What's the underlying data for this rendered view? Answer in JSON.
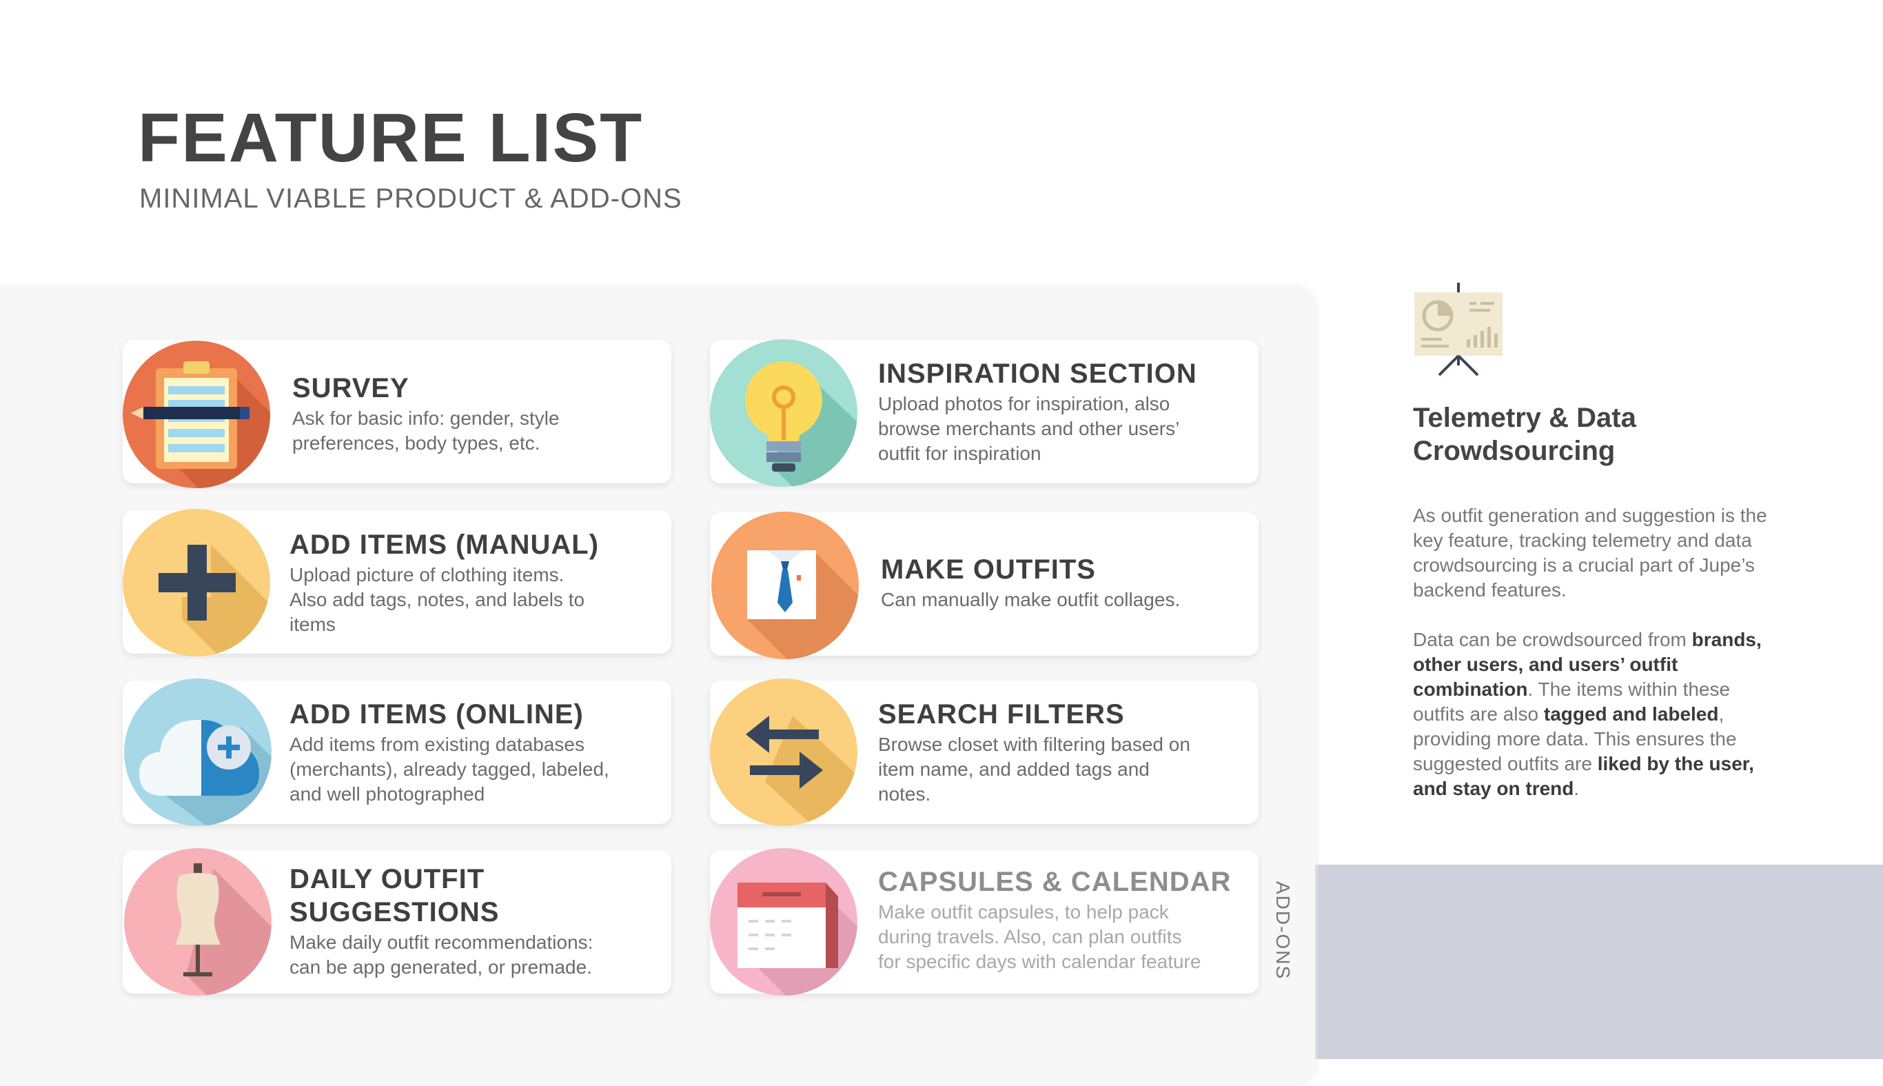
{
  "header": {
    "title": "FEATURE LIST",
    "subtitle": "MINIMAL VIABLE PRODUCT & ADD-ONS"
  },
  "features": [
    {
      "title": "SURVEY",
      "desc": "Ask for basic info: gender, style\npreferences, body types, etc.",
      "icon": "survey-clipboard-icon"
    },
    {
      "title": "INSPIRATION SECTION",
      "desc": "Upload photos for inspiration, also\nbrowse merchants and other users’\noutfit for inspiration",
      "icon": "lightbulb-icon"
    },
    {
      "title": "ADD ITEMS (MANUAL)",
      "desc": "Upload picture of clothing items.\nAlso add tags, notes, and labels to\nitems",
      "icon": "plus-icon"
    },
    {
      "title": "MAKE OUTFITS",
      "desc": "Can manually make outfit collages.",
      "icon": "shirt-tie-icon"
    },
    {
      "title": "ADD ITEMS (ONLINE)",
      "desc": "Add items from existing databases\n(merchants), already tagged, labeled,\nand well photographed",
      "icon": "cloud-add-icon"
    },
    {
      "title": "SEARCH FILTERS",
      "desc": "Browse closet with filtering based on\nitem name, and added tags and\nnotes.",
      "icon": "swap-arrows-icon"
    },
    {
      "title": "DAILY OUTFIT\nSUGGESTIONS",
      "desc": "Make daily outfit recommendations:\ncan be app generated, or premade.",
      "icon": "mannequin-icon"
    },
    {
      "title": "CAPSULES & CALENDAR",
      "desc": "Make outfit capsules, to help pack\nduring travels. Also, can plan outfits\nfor specific days with calendar feature",
      "icon": "calendar-icon"
    }
  ],
  "addons_label": "ADD-ONS",
  "sidebar": {
    "icon": "presentation-board-icon",
    "title": "Telemetry & Data\nCrowdsourcing",
    "para1": "As outfit generation and suggestion is the key feature, tracking telemetry and data crowdsourcing is a crucial part of Jupe’s backend features.",
    "para2": {
      "t1": "Data can be crowdsourced from ",
      "b1": "brands, other users, and users’ outfit combination",
      "t2": ". The items within these outfits are also ",
      "b2": "tagged and labeled",
      "t3": ", providing more data. This ensures the suggested outfits are ",
      "b3": "liked by the user, and stay on trend",
      "t4": "."
    }
  },
  "colors": {
    "survey": "#e9744b",
    "inspiration": "#a3dfd2",
    "manual": "#fbd07e",
    "outfits": "#f7a369",
    "online": "#a7d8e8",
    "search": "#fbd07e",
    "daily": "#f7b1b7",
    "capsules": "#f6a9c1",
    "gray_block": "#ced1db"
  }
}
